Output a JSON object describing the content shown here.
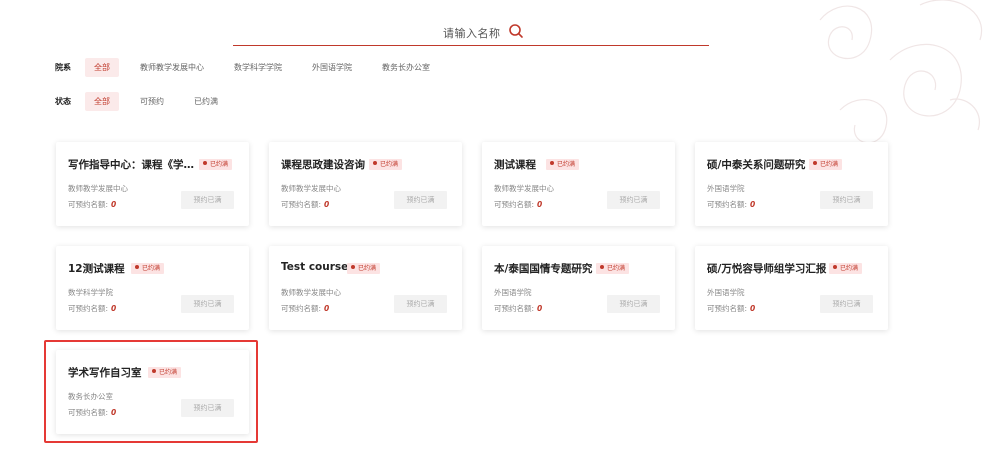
{
  "search": {
    "placeholder": "请输入名称"
  },
  "filters": {
    "dept": {
      "label": "院系",
      "options": [
        "全部",
        "教师教学发展中心",
        "数学科学学院",
        "外国语学院",
        "教务长办公室"
      ],
      "active": 0
    },
    "status": {
      "label": "状态",
      "options": [
        "全部",
        "可预约",
        "已约满"
      ],
      "active": 0
    }
  },
  "quota_label": "可预约名额:",
  "cards": [
    {
      "title": "写作指导中心：课程《学…",
      "badge": "已约满",
      "dept": "教师教学发展中心",
      "quota": "0",
      "button": "预约已满"
    },
    {
      "title": "课程思政建设咨询",
      "badge": "已约满",
      "dept": "教师教学发展中心",
      "quota": "0",
      "button": "预约已满"
    },
    {
      "title": "测试课程",
      "badge": "已约满",
      "dept": "教师教学发展中心",
      "quota": "0",
      "button": "预约已满"
    },
    {
      "title": "硕/中泰关系问题研究",
      "badge": "已约满",
      "dept": "外国语学院",
      "quota": "0",
      "button": "预约已满"
    },
    {
      "title": "12测试课程",
      "badge": "已约满",
      "dept": "数学科学学院",
      "quota": "0",
      "button": "预约已满"
    },
    {
      "title": "Test course",
      "badge": "已约满",
      "dept": "教师教学发展中心",
      "quota": "0",
      "button": "预约已满"
    },
    {
      "title": "本/泰国国情专题研究",
      "badge": "已约满",
      "dept": "外国语学院",
      "quota": "0",
      "button": "预约已满"
    },
    {
      "title": "硕/万悦容导师组学习汇报",
      "badge": "已约满",
      "dept": "外国语学院",
      "quota": "0",
      "button": "预约已满"
    },
    {
      "title": "学术写作自习室",
      "badge": "已约满",
      "dept": "教务长办公室",
      "quota": "0",
      "button": "预约已满"
    }
  ],
  "colors": {
    "accent": "#c0392b",
    "badge_bg": "#fce3e3",
    "highlight": "#e53935"
  }
}
